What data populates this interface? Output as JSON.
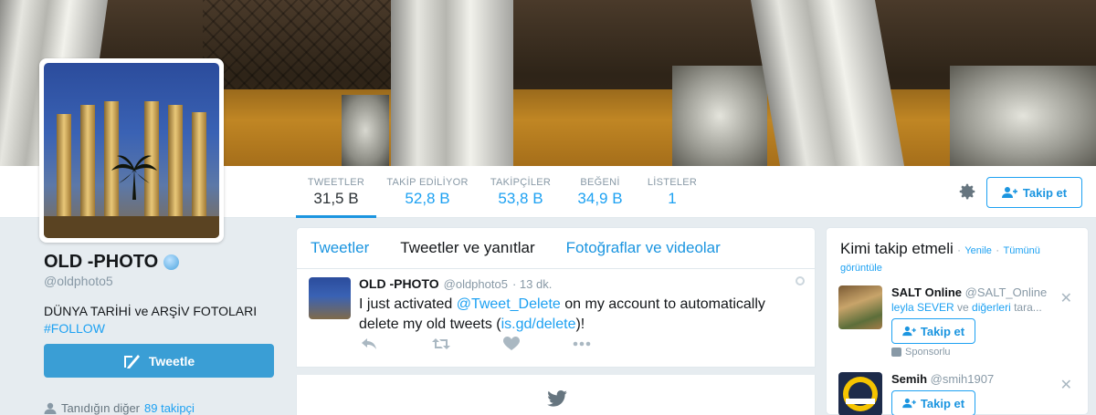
{
  "profile": {
    "name": "OLD -PHOTO",
    "handle": "@oldphoto5",
    "bio_line1": "DÜNYA TARİHİ ve ARŞİV FOTOLARI",
    "bio_tag": "#FOLLOW",
    "tweet_button": "Tweetle",
    "followers_known": "Tanıdığın diğer",
    "followers_link": "89 takipçi"
  },
  "stats": [
    {
      "label": "TWEETLER",
      "value": "31,5 B"
    },
    {
      "label": "TAKİP EDİLİYOR",
      "value": "52,8 B"
    },
    {
      "label": "TAKİPÇİLER",
      "value": "53,8 B"
    },
    {
      "label": "BEĞENİ",
      "value": "34,9 B"
    },
    {
      "label": "LİSTELER",
      "value": "1"
    }
  ],
  "header": {
    "follow_label": "Takip et"
  },
  "timeline": {
    "tabs": [
      "Tweetler",
      "Tweetler ve yanıtlar",
      "Fotoğraflar ve videolar"
    ],
    "tweet": {
      "name": "OLD -PHOTO",
      "handle": "@oldphoto5",
      "time": "· 13 dk.",
      "text_1": "I just activated ",
      "mention": "@Tweet_Delete",
      "text_2": " on my account to automatically delete my old tweets (",
      "link": "is.gd/delete",
      "text_3": ")!"
    }
  },
  "who_to_follow": {
    "title": "Kimi takip etmeli",
    "sep": "·",
    "refresh": "Yenile",
    "view_all": "Tümünü görüntüle",
    "suggestions": [
      {
        "name": "SALT Online",
        "handle": "@SALT_Online",
        "link": "leyla SEVER",
        "rest": " ve ",
        "link2": "diğerleri",
        "rest2": " tara...",
        "button": "Takip et",
        "sponsored": "Sponsorlu"
      },
      {
        "name": "Semih",
        "handle": "@smih1907",
        "button": "Takip et"
      }
    ]
  },
  "colors": {
    "accent": "#1da1f2",
    "tweet_button": "#3a9ed5"
  }
}
